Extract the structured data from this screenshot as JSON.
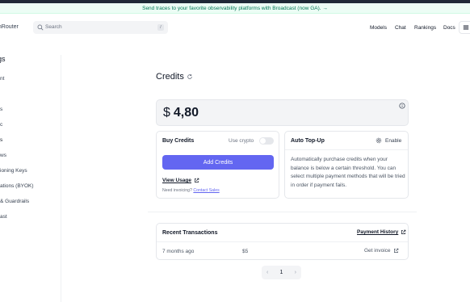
{
  "announcement": "Send traces to your favorite observability platforms with Broadcast (now GA). →",
  "brand": "enRouter",
  "search": {
    "placeholder": "Search",
    "shortcut": "/"
  },
  "nav": {
    "links": [
      "Models",
      "Chat",
      "Rankings",
      "Docs"
    ]
  },
  "sidebar": {
    "title": "gs",
    "items": [
      {
        "label": "nt"
      },
      {
        "label": "s"
      },
      {
        "label": "c"
      },
      {
        "label": "s"
      },
      {
        "label": "ws"
      },
      {
        "label": "ioning Keys"
      },
      {
        "label": "ations (BYOK)"
      },
      {
        "label": "& Guardrails"
      },
      {
        "label": "ast"
      }
    ]
  },
  "main": {
    "title": "Credits",
    "balance": {
      "currency": "$",
      "amount": "4,80"
    },
    "buy_credits": {
      "title": "Buy Credits",
      "use_crypto_label": "Use crypto",
      "add_button": "Add Credits",
      "view_usage": "View Usage",
      "invoicing_prefix": "Need invoicing?",
      "contact_sales": "Contact Sales"
    },
    "auto_topup": {
      "title": "Auto Top-Up",
      "enable_label": "Enable",
      "description": "Automatically purchase credits when your balance is below a certain threshold. You can select multiple payment methods that will be tried in order if payment fails."
    },
    "transactions": {
      "title": "Recent Transactions",
      "history_link": "Payment History",
      "rows": [
        {
          "time": "7 months ago",
          "amount": "$5",
          "action": "Get invoice"
        }
      ]
    },
    "pagination": {
      "prev": "‹",
      "page": "1",
      "next": "›"
    }
  },
  "colors": {
    "accent": "#6366f1",
    "banner_text": "#047857",
    "banner_bg": "#ecfdf5"
  }
}
